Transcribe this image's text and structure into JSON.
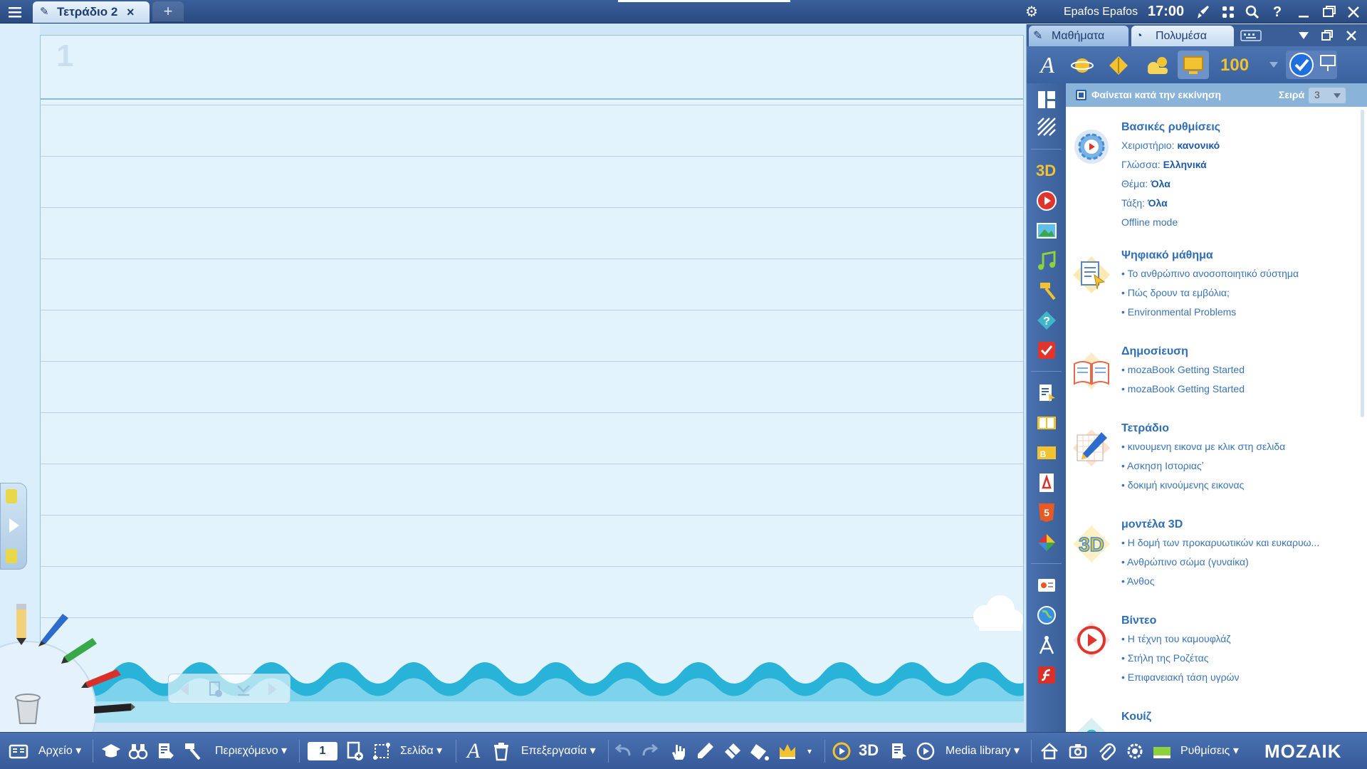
{
  "topbar": {
    "tab_title": "Τετράδιο 2",
    "tab_close": "×",
    "new_tab": "+",
    "user": "Epafos Epafos",
    "time": "17:00"
  },
  "page": {
    "page_number": "1"
  },
  "panel": {
    "tab_lessons": "Μαθήματα",
    "tab_media": "Πολυμέσα",
    "score_label": "100",
    "option_checkbox_label": "Φαίνεται κατά την εκκίνηση",
    "order_label": "Σειρά",
    "order_value": "3",
    "sections": [
      {
        "title": "Βασικές ρυθμίσεις",
        "icon": "settings-gear-icon",
        "lines": [
          {
            "key": "Χειριστήριο:",
            "value": "κανονικό"
          },
          {
            "key": "Γλώσσα:",
            "value": "Ελληνικά"
          },
          {
            "key": "Θέμα:",
            "value": "Όλα"
          },
          {
            "key": "Τάξη:",
            "value": "Όλα"
          },
          {
            "key": "Offline mode",
            "value": ""
          }
        ]
      },
      {
        "title": "Ψηφιακό μάθημα",
        "icon": "digital-lesson-icon",
        "items": [
          "Το ανθρώπινο ανοσοποιητικό σύστημα",
          "Πώς δρουν τα εμβόλια;",
          "Environmental Problems"
        ]
      },
      {
        "title": "Δημοσίευση",
        "icon": "publication-book-icon",
        "items": [
          "mozaBook Getting Started",
          "mozaBook Getting Started"
        ]
      },
      {
        "title": "Τετράδιο",
        "icon": "notebook-pencil-icon",
        "items": [
          "κινουμενη εικονα με κλικ στη σελιδα",
          "Ασκηση Ιστοριαςʼ",
          "δοκιμή κινούμενης εικονας"
        ]
      },
      {
        "title": "μοντέλα 3D",
        "icon": "3d-models-icon",
        "items": [
          "Η δομή των προκαρυωτικών και ευκαρυω...",
          "Ανθρώπινο σώμα (γυναίκα)",
          "Άνθος"
        ]
      },
      {
        "title": "Βίντεο",
        "icon": "video-play-icon",
        "items": [
          "Η τέχνη του καμουφλάζ",
          "Στήλη της Ροζέτας",
          "Επιφανειακή τάση υγρών"
        ]
      },
      {
        "title": "Κουίζ",
        "icon": "quiz-icon",
        "items": []
      }
    ]
  },
  "bottombar": {
    "file": "Αρχείο",
    "content": "Περιεχόμενο",
    "page_input": "1",
    "page": "Σελίδα",
    "edit": "Επεξεργασία",
    "media_library": "Media library",
    "settings": "Ρυθμίσεις",
    "logo": "MOZAIK"
  },
  "colors": {
    "bar_blue": "#3a5f99",
    "link_blue": "#3b74b6",
    "sea": "#2ab3d8",
    "page_bg": "#e3f3fc"
  }
}
